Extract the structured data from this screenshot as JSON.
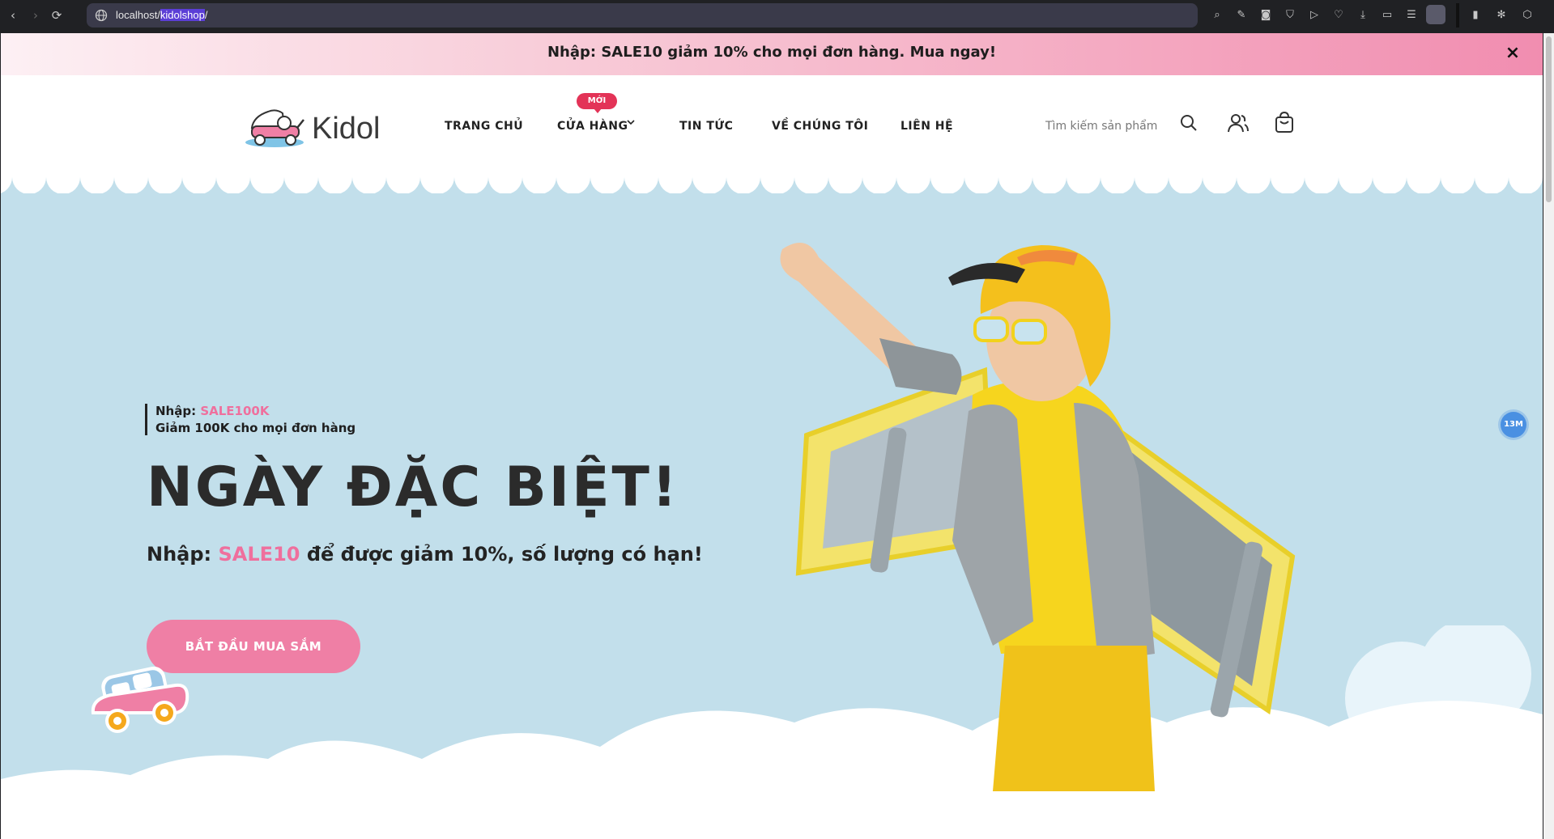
{
  "browser": {
    "url_prefix": "localhost/",
    "url_highlight": "kidolshop",
    "url_suffix": "/"
  },
  "announcement": {
    "text": "Nhập: SALE10 giảm 10% cho mọi đơn hàng. Mua ngay!",
    "close_glyph": "×"
  },
  "header": {
    "brand": "Kidol",
    "menu": [
      {
        "label": "TRANG CHỦ"
      },
      {
        "label": "CỬA HÀNG",
        "badge": "MỚI"
      },
      {
        "label": "TIN TỨC"
      },
      {
        "label": "VỀ CHÚNG TÔI"
      },
      {
        "label": "LIÊN HỆ"
      }
    ],
    "search_placeholder": "Tìm kiếm sản phẩm"
  },
  "hero": {
    "promo_label": "Nhập:",
    "promo_code": "SALE100K",
    "promo_desc": "Giảm 100K cho mọi đơn hàng",
    "headline": "NGÀY ĐẶC BIỆT!",
    "sub_prefix": "Nhập:",
    "sub_code": "SALE10",
    "sub_suffix": "để được giảm 10%, số lượng có hạn!",
    "cta": "BẮT ĐẦU MUA SẮM"
  },
  "floating_chip": "13M",
  "colors": {
    "accent_pink": "#ef7fa5",
    "hero_bg": "#c2dfeb",
    "badge_red": "#e33357"
  },
  "icons": [
    "back-icon",
    "forward-icon",
    "reload-icon",
    "globe-icon",
    "search-icon",
    "user-icon",
    "cart-icon",
    "chevron-down-icon",
    "close-icon"
  ]
}
